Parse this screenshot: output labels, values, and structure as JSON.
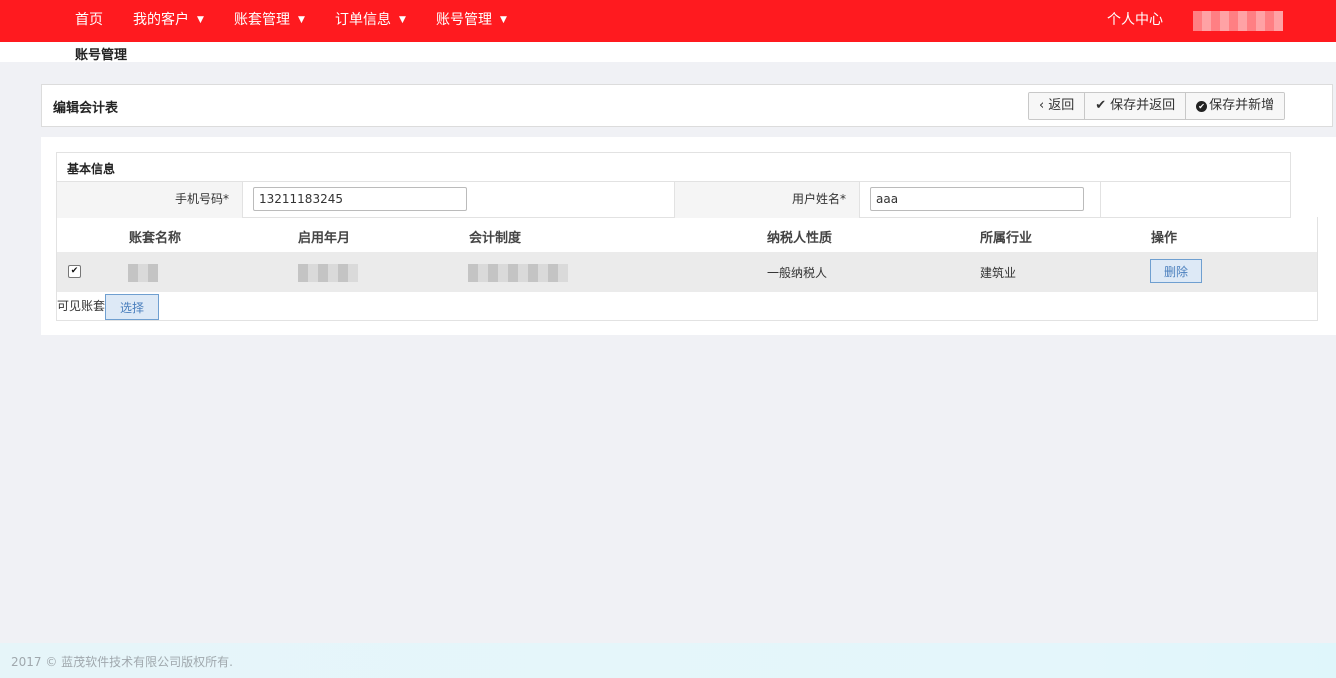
{
  "nav": {
    "items": [
      {
        "label": "首页",
        "dropdown": false
      },
      {
        "label": "我的客户",
        "dropdown": true
      },
      {
        "label": "账套管理",
        "dropdown": true
      },
      {
        "label": "订单信息",
        "dropdown": true
      },
      {
        "label": "账号管理",
        "dropdown": true
      }
    ],
    "personal_center": "个人中心",
    "caret": "▼"
  },
  "breadcrumb": "账号管理",
  "panel": {
    "title": "编辑会计表",
    "back_label": "返回",
    "save_return_label": "保存并返回",
    "save_new_label": "保存并新增"
  },
  "basic_info": {
    "title": "基本信息",
    "phone_label": "手机号码*",
    "phone_value": "13211183245",
    "username_label": "用户姓名*",
    "username_value": "aaa"
  },
  "table": {
    "headers": [
      "账套名称",
      "启用年月",
      "会计制度",
      "纳税人性质",
      "所属行业",
      "操作"
    ],
    "rows": [
      {
        "checked": true,
        "taxpayer": "一般纳税人",
        "industry": "建筑业",
        "action": "删除"
      }
    ]
  },
  "visible_books": {
    "label": "可见账套",
    "select_label": "选择"
  },
  "footer": "2017 © 蓝茂软件技术有限公司版权所有.",
  "colors": {
    "topbar": "#ff1a1f",
    "page_bg": "#f0f1f5",
    "action_button_border": "#6f9fd0"
  }
}
